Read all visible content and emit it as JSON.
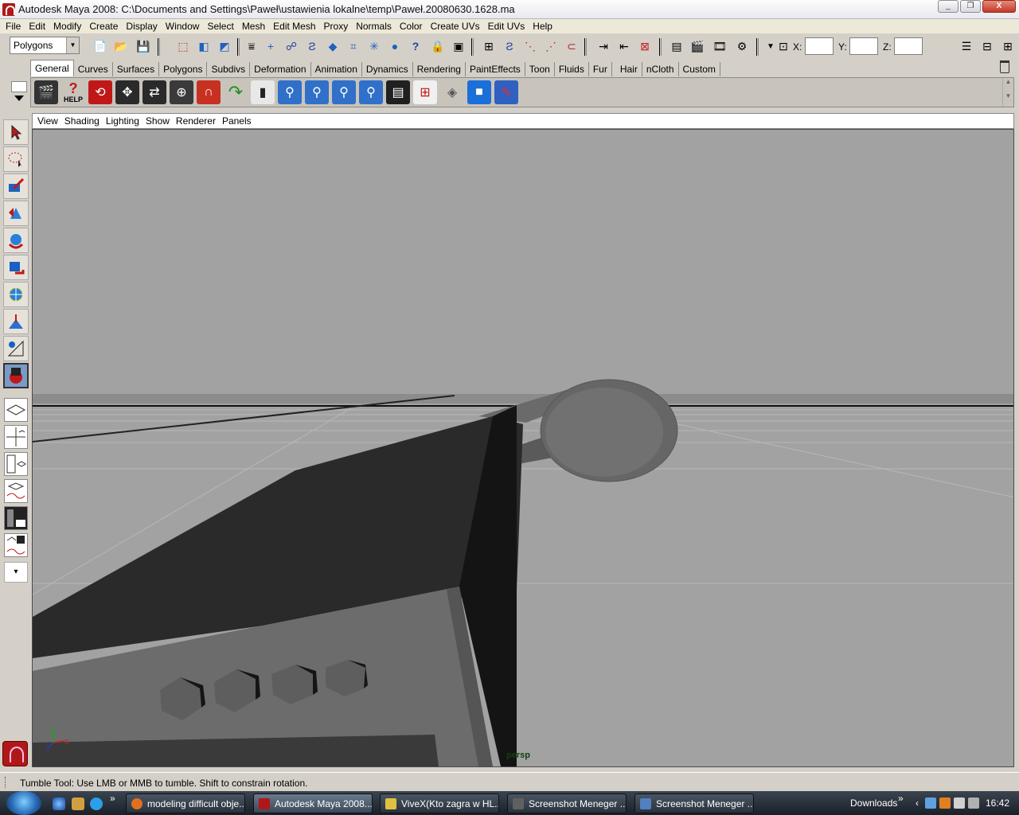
{
  "window": {
    "title": "Autodesk Maya 2008: C:\\Documents and Settings\\Paweł\\ustawienia lokalne\\temp\\Paweł.20080630.1628.ma",
    "minimize": "_",
    "restore": "❐",
    "close": "X"
  },
  "menubar": [
    "File",
    "Edit",
    "Modify",
    "Create",
    "Display",
    "Window",
    "Select",
    "Mesh",
    "Edit Mesh",
    "Proxy",
    "Normals",
    "Color",
    "Create UVs",
    "Edit UVs",
    "Help"
  ],
  "statusline": {
    "mode": "Polygons",
    "x_label": "X:",
    "y_label": "Y:",
    "z_label": "Z:",
    "x_value": "",
    "y_value": "",
    "z_value": ""
  },
  "shelf_tabs": [
    "General",
    "Curves",
    "Surfaces",
    "Polygons",
    "Subdivs",
    "Deformation",
    "Animation",
    "Dynamics",
    "Rendering",
    "PaintEffects",
    "Toon",
    "Fluids",
    "Fur",
    "Hair",
    "nCloth",
    "Custom"
  ],
  "shelf_tabs_active": "General",
  "shelf": {
    "help_label": "HELP",
    "icons": [
      "film-clapper-icon",
      "help-icon",
      "camera-tumble-icon",
      "camera-track-icon",
      "camera-dolly-icon",
      "camera-zoom-icon",
      "magnet-icon",
      "redo-icon",
      "paint-bucket-icon",
      "joints-1-icon",
      "joints-2-icon",
      "joints-3-icon",
      "joints-4-icon",
      "script-editor-icon",
      "hypergraph-icon",
      "shader-icon",
      "cube-icon",
      "paint-icon"
    ]
  },
  "viewport": {
    "panel_menu": [
      "View",
      "Shading",
      "Lighting",
      "Show",
      "Renderer",
      "Panels"
    ],
    "camera_label": "persp",
    "axis_x": "x",
    "axis_y": "y",
    "axis_z": "z"
  },
  "helpline": "Tumble Tool: Use LMB or MMB to tumble. Shift to constrain rotation.",
  "taskbar": {
    "more": "»",
    "tasks": [
      {
        "label": "modeling difficult obje...",
        "color": "#e07020"
      },
      {
        "label": "Autodesk Maya 2008...",
        "color": "#b01818"
      },
      {
        "label": "ViveX(Kto zagra w HL...",
        "color": "#e0c040"
      },
      {
        "label": "Screenshot Meneger ...",
        "color": "#606060"
      },
      {
        "label": "Screenshot Meneger ...",
        "color": "#5080c0"
      }
    ],
    "active_task": 1,
    "tray_label": "Downloads",
    "tray_more": "»",
    "clock": "16:42"
  }
}
